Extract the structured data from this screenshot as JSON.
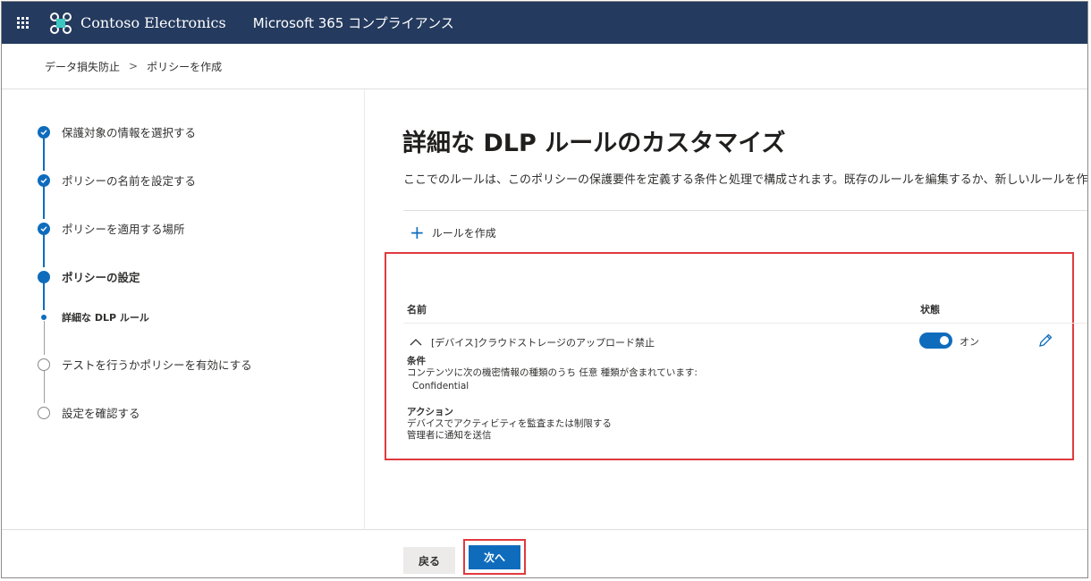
{
  "header": {
    "org_name": "Contoso Electronics",
    "app_name": "Microsoft 365 コンプライアンス",
    "bar_color": "#243a5e"
  },
  "breadcrumb": {
    "items": [
      "データ損失防止",
      "ポリシーを作成"
    ],
    "separator": ">"
  },
  "wizard": {
    "steps": [
      {
        "label": "保護対象の情報を選択する",
        "status": "completed"
      },
      {
        "label": "ポリシーの名前を設定する",
        "status": "completed"
      },
      {
        "label": "ポリシーを適用する場所",
        "status": "completed"
      },
      {
        "label": "ポリシーの設定",
        "status": "current"
      },
      {
        "label": "詳細な DLP ルール",
        "status": "current-substep"
      },
      {
        "label": "テストを行うかポリシーを有効にする",
        "status": "not-started"
      },
      {
        "label": "設定を確認する",
        "status": "not-started"
      }
    ]
  },
  "main": {
    "title": "詳細な DLP ルールのカスタマイズ",
    "description": "ここでのルールは、このポリシーの保護要件を定義する条件と処理で構成されます。既存のルールを編集するか、新しいルールを作成することが",
    "create_rule_label": "ルールを作成",
    "columns": {
      "name": "名前",
      "status": "状態"
    },
    "rule": {
      "name": "[デバイス]クラウドストレージのアップロード禁止",
      "toggle_on": true,
      "toggle_label": "オン",
      "conditions_heading": "条件",
      "conditions_text": "コンテンツに次の機密情報の種類のうち 任意 種類が含まれています:",
      "conditions_value": "Confidential",
      "actions_heading": "アクション",
      "actions": [
        "デバイスでアクティビティを監査または制限する",
        "管理者に通知を送信"
      ]
    }
  },
  "footer": {
    "back_label": "戻る",
    "next_label": "次へ"
  },
  "colors": {
    "accent": "#0f6cbd",
    "highlight": "#e03a3e"
  }
}
